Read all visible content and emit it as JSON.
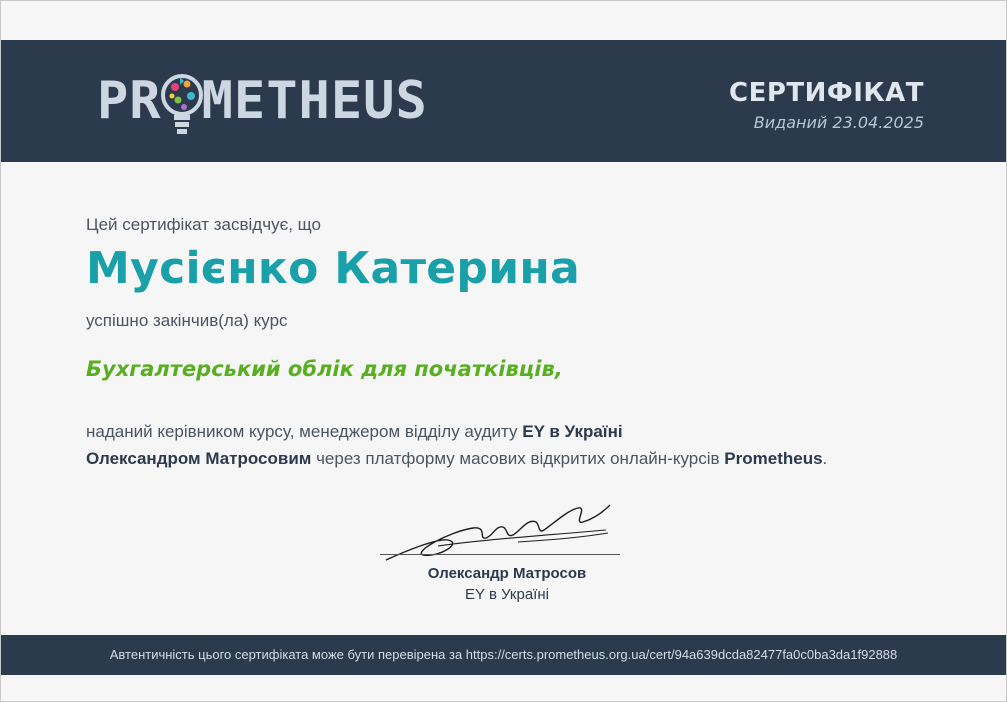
{
  "header": {
    "logo_left": "PR",
    "logo_right": "METHEUS",
    "title": "СЕРТИФІКАТ",
    "issued": "Виданий 23.04.2025"
  },
  "body": {
    "intro": "Цей сертифікат засвідчує, що",
    "recipient": "Мусієнко Катерина",
    "completed": "успішно закінчив(ла) курс",
    "course": "Бухгалтерський облік для початківців,",
    "desc_1": "наданий керівником курсу, менеджером відділу аудиту ",
    "org_bold": "EY в Україні",
    "instructor_bold": "Олександром Матросовим",
    "desc_2": " через платформу масових відкритих онлайн-курсів ",
    "platform_bold": "Prometheus",
    "desc_end": "."
  },
  "signature": {
    "signer": "Олександр Матросов",
    "org": "EY в Україні"
  },
  "footer": {
    "text": "Автентичність цього сертифіката може бути перевірена за https://certs.prometheus.org.ua/cert/94a639dcda82477fa0c0ba3da1f92888"
  },
  "colors": {
    "header_bg": "#2c3a4d",
    "name": "#19a0a8",
    "course": "#5aae22",
    "page_bg": "#f6f6f7"
  }
}
